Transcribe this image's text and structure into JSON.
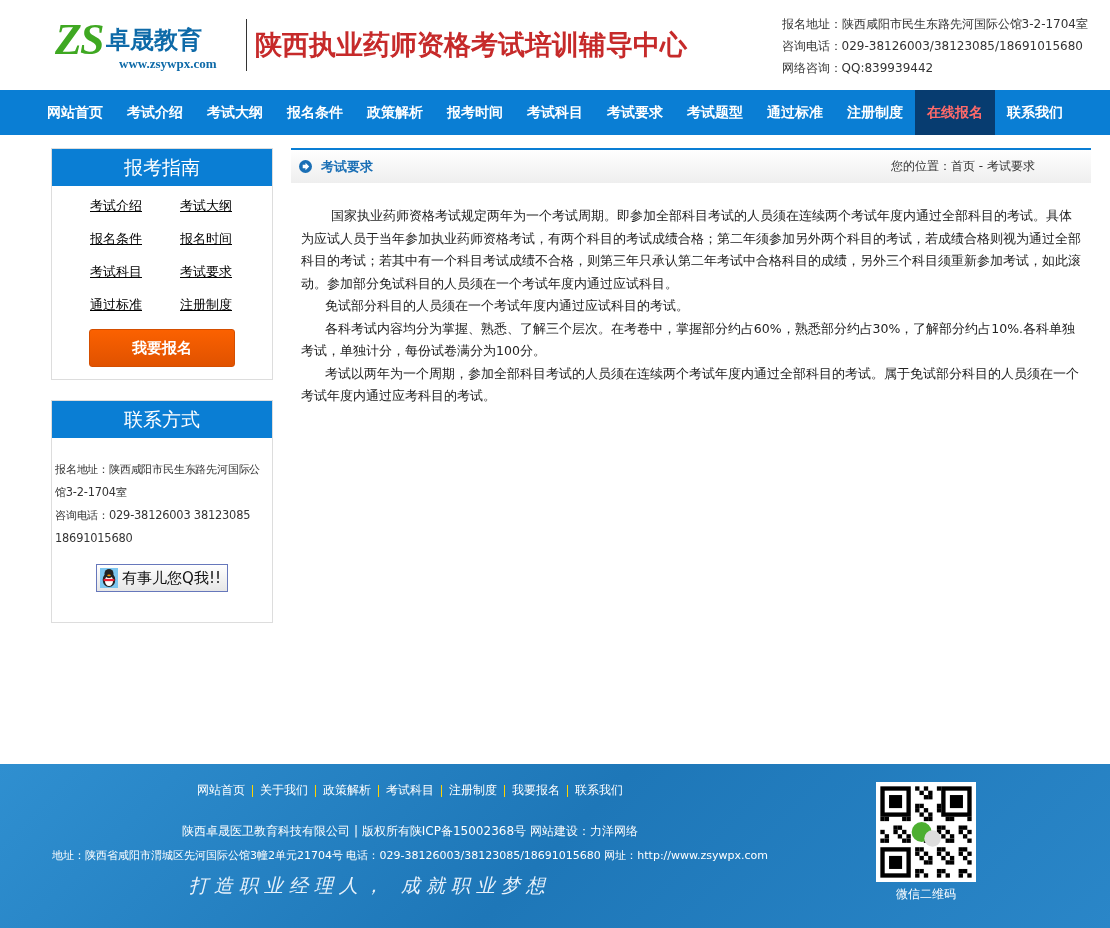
{
  "header": {
    "logo_letters": "ZS",
    "logo_name": "卓晟教育",
    "logo_url": "www.zsywpx.com",
    "site_title": "陕西执业药师资格考试培训辅导中心",
    "contact_lines": [
      "报名地址：陕西咸阳市民生东路先河国际公馆3-2-1704室",
      "咨询电话：029-38126003/38123085/18691015680",
      "网络咨询：QQ:839939442"
    ]
  },
  "nav": [
    {
      "label": "网站首页",
      "highlighted": false
    },
    {
      "label": "考试介绍",
      "highlighted": false
    },
    {
      "label": "考试大纲",
      "highlighted": false
    },
    {
      "label": "报名条件",
      "highlighted": false
    },
    {
      "label": "政策解析",
      "highlighted": false
    },
    {
      "label": "报考时间",
      "highlighted": false
    },
    {
      "label": "考试科目",
      "highlighted": false
    },
    {
      "label": "考试要求",
      "highlighted": false
    },
    {
      "label": "考试题型",
      "highlighted": false
    },
    {
      "label": "通过标准",
      "highlighted": false
    },
    {
      "label": "注册制度",
      "highlighted": false
    },
    {
      "label": "在线报名",
      "highlighted": true
    },
    {
      "label": "联系我们",
      "highlighted": false
    }
  ],
  "guide": {
    "title": "报考指南",
    "links": [
      "考试介绍",
      "考试大纲",
      "报名条件",
      "报名时间",
      "考试科目",
      "考试要求",
      "通过标准",
      "注册制度"
    ],
    "button": "我要报名"
  },
  "contact": {
    "title": "联系方式",
    "lines": [
      "报名地址：陕西咸阳市民生东路先河国际公馆3-2-1704室",
      "咨询电话：029-38126003 38123085 18691015680"
    ],
    "qq_button": "有事儿您Q我!!"
  },
  "article": {
    "title": "考试要求",
    "breadcrumb": "您的位置：首页 - 考试要求",
    "paragraphs": [
      "国家执业药师资格考试规定两年为一个考试周期。即参加全部科目考试的人员须在连续两个考试年度内通过全部科目的考试。具体为应试人员于当年参加执业药师资格考试，有两个科目的考试成绩合格；第二年须参加另外两个科目的考试，若成绩合格则视为通过全部科目的考试；若其中有一个科目考试成绩不合格，则第三年只承认第二年考试中合格科目的成绩，另外三个科目须重新参加考试，如此滚动。参加部分免试科目的人员须在一个考试年度内通过应试科目。",
      "免试部分科目的人员须在一个考试年度内通过应试科目的考试。",
      "各科考试内容均分为掌握、熟悉、了解三个层次。在考卷中，掌握部分约占60%，熟悉部分约占30%，了解部分约占10%.各科单独考试，单独计分，每份试卷满分为100分。",
      "考试以两年为一个周期，参加全部科目考试的人员须在连续两个考试年度内通过全部科目的考试。属于免试部分科目的人员须在一个考试年度内通过应考科目的考试。"
    ]
  },
  "footer": {
    "links": [
      "网站首页",
      "关于我们",
      "政策解析",
      "考试科目",
      "注册制度",
      "我要报名",
      "联系我们"
    ],
    "company": "陕西卓晟医卫教育科技有限公司 | 版权所有陕ICP备15002368号 网站建设：力洋网络",
    "address": "地址：陕西省咸阳市渭城区先河国际公馆3幢2单元21704号 电话：029-38126003/38123085/18691015680 网址：http://www.zsywpx.com",
    "slogan": "打造职业经理人， 成就职业梦想",
    "qr_caption": "微信二维码"
  }
}
